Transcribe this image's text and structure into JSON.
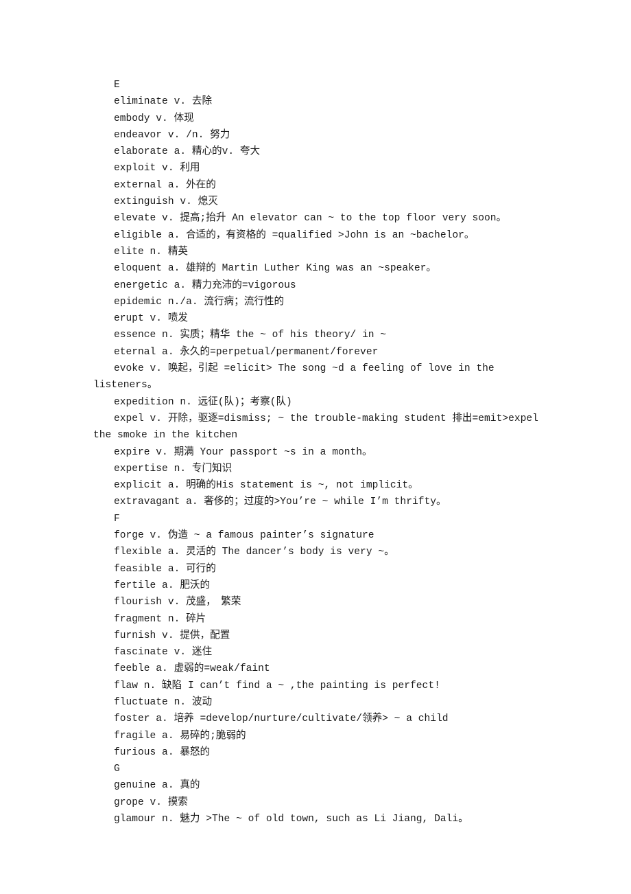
{
  "document": {
    "page_background": "#ffffff",
    "text_color": "#1a1a1a",
    "blocks": [
      {
        "kind": "section-letter",
        "text": "E"
      },
      {
        "kind": "entry",
        "text": "eliminate v. 去除"
      },
      {
        "kind": "entry",
        "text": "embody v. 体现"
      },
      {
        "kind": "entry",
        "text": "endeavor v. /n. 努力"
      },
      {
        "kind": "entry",
        "text": "elaborate a. 精心的v. 夸大"
      },
      {
        "kind": "entry",
        "text": "exploit v. 利用"
      },
      {
        "kind": "entry",
        "text": "external a. 外在的"
      },
      {
        "kind": "entry",
        "text": "extinguish v. 熄灭"
      },
      {
        "kind": "entry",
        "text": "elevate v. 提高;抬升 An elevator can ~ to the top floor very soon。"
      },
      {
        "kind": "entry",
        "text": "eligible a. 合适的，有资格的 =qualified >John is an ~bachelor。"
      },
      {
        "kind": "entry",
        "text": "elite n. 精英"
      },
      {
        "kind": "entry",
        "text": "eloquent a. 雄辩的 Martin Luther King was an ~speaker。"
      },
      {
        "kind": "entry",
        "text": "energetic a. 精力充沛的=vigorous"
      },
      {
        "kind": "entry",
        "text": "epidemic n./a. 流行病；流行性的"
      },
      {
        "kind": "entry",
        "text": "erupt v. 喷发"
      },
      {
        "kind": "entry",
        "text": "essence n. 实质；精华 the ~ of his theory/ in ~"
      },
      {
        "kind": "entry",
        "text": "eternal a. 永久的=perpetual/permanent/forever"
      },
      {
        "kind": "entry",
        "text": "evoke v. 唤起，引起 =elicit> The song ~d a feeling of love in the listeners。"
      },
      {
        "kind": "entry",
        "text": "expedition n. 远征(队)；考察(队)"
      },
      {
        "kind": "entry",
        "text": "expel v. 开除，驱逐=dismiss; ~ the trouble-making student 排出=emit>expel the smoke in the kitchen"
      },
      {
        "kind": "entry",
        "text": "expire v. 期满 Your passport ~s in a month。"
      },
      {
        "kind": "entry",
        "text": "expertise n. 专门知识"
      },
      {
        "kind": "entry",
        "text": "explicit a. 明确的His statement is ~, not implicit。"
      },
      {
        "kind": "entry",
        "text": "extravagant a. 奢侈的；过度的>You’re ~ while I’m thrifty。"
      },
      {
        "kind": "section-letter",
        "text": "F"
      },
      {
        "kind": "entry",
        "text": "forge v. 伪造 ~ a famous painter’s signature"
      },
      {
        "kind": "entry",
        "text": "flexible a. 灵活的 The dancer’s body is very ~。"
      },
      {
        "kind": "entry",
        "text": "feasible a. 可行的"
      },
      {
        "kind": "entry",
        "text": "fertile a. 肥沃的"
      },
      {
        "kind": "entry",
        "text": "flourish v. 茂盛，　繁荣"
      },
      {
        "kind": "entry",
        "text": "fragment n. 碎片"
      },
      {
        "kind": "entry",
        "text": "furnish v. 提供，配置"
      },
      {
        "kind": "entry",
        "text": "fascinate v. 迷住"
      },
      {
        "kind": "entry",
        "text": "feeble a. 虚弱的=weak/faint"
      },
      {
        "kind": "entry",
        "text": "flaw n. 缺陷 I can’t find a ~ ,the painting is perfect!"
      },
      {
        "kind": "entry",
        "text": "fluctuate n. 波动"
      },
      {
        "kind": "entry",
        "text": "foster a. 培养 =develop/nurture/cultivate/领养> ~ a child"
      },
      {
        "kind": "entry",
        "text": "fragile a. 易碎的;脆弱的"
      },
      {
        "kind": "entry",
        "text": "furious a. 暴怒的"
      },
      {
        "kind": "section-letter",
        "text": "G"
      },
      {
        "kind": "entry",
        "text": "genuine a. 真的"
      },
      {
        "kind": "entry",
        "text": "grope v. 摸索"
      },
      {
        "kind": "entry",
        "text": "glamour n. 魅力 >The ~ of old town, such as Li Jiang, Dali。"
      }
    ]
  }
}
